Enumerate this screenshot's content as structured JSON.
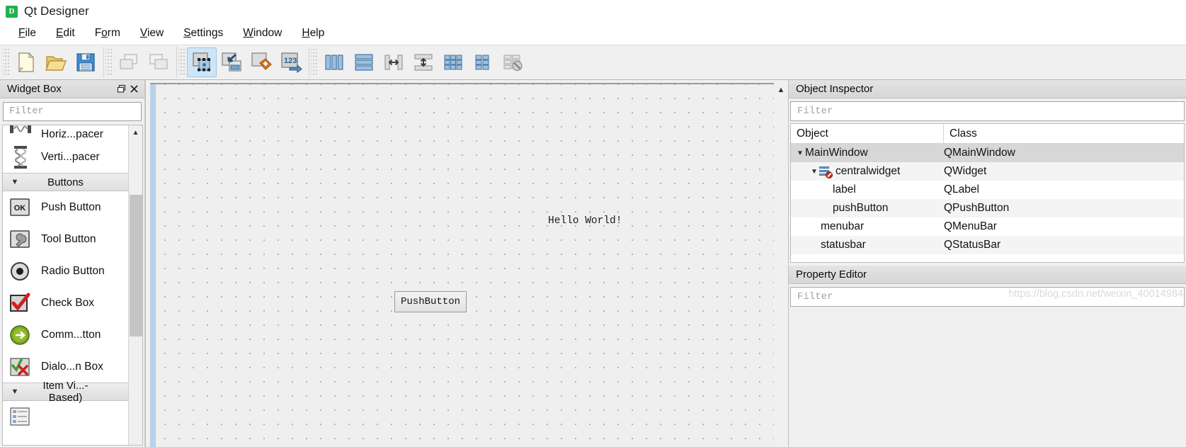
{
  "window": {
    "title": "Qt Designer",
    "icon": "qt-designer-icon",
    "icon_letter": "D"
  },
  "menubar": {
    "items": [
      {
        "label": "File",
        "mnemonic": "F"
      },
      {
        "label": "Edit",
        "mnemonic": "E"
      },
      {
        "label": "Form",
        "mnemonic": "o"
      },
      {
        "label": "View",
        "mnemonic": "V"
      },
      {
        "label": "Settings",
        "mnemonic": "S"
      },
      {
        "label": "Window",
        "mnemonic": "W"
      },
      {
        "label": "Help",
        "mnemonic": "H"
      }
    ]
  },
  "toolbar": {
    "groups": [
      {
        "buttons": [
          {
            "name": "new-form-button",
            "icon": "new-document-icon",
            "active": false
          },
          {
            "name": "open-form-button",
            "icon": "open-folder-icon",
            "active": false
          },
          {
            "name": "save-form-button",
            "icon": "save-floppy-icon",
            "active": false
          }
        ]
      },
      {
        "buttons": [
          {
            "name": "undo-button",
            "icon": "undo-cascade-icon",
            "active": false
          },
          {
            "name": "redo-button",
            "icon": "redo-cascade-icon",
            "active": false
          }
        ]
      },
      {
        "buttons": [
          {
            "name": "edit-widgets-button",
            "icon": "edit-widgets-icon",
            "active": true
          },
          {
            "name": "edit-signals-slots-button",
            "icon": "edit-signals-slots-icon",
            "active": false
          },
          {
            "name": "edit-buddies-button",
            "icon": "edit-buddies-icon",
            "active": false
          },
          {
            "name": "edit-tab-order-button",
            "icon": "edit-tab-order-icon",
            "active": false
          }
        ]
      },
      {
        "buttons": [
          {
            "name": "layout-horizontally-button",
            "icon": "layout-horizontal-icon",
            "active": false
          },
          {
            "name": "layout-vertically-button",
            "icon": "layout-vertical-icon",
            "active": false
          },
          {
            "name": "layout-splitter-horizontal-button",
            "icon": "splitter-horizontal-icon",
            "active": false
          },
          {
            "name": "layout-splitter-vertical-button",
            "icon": "splitter-vertical-icon",
            "active": false
          },
          {
            "name": "layout-grid-button",
            "icon": "layout-grid-icon",
            "active": false
          },
          {
            "name": "layout-form-button",
            "icon": "layout-form-icon",
            "active": false
          },
          {
            "name": "break-layout-button",
            "icon": "break-layout-icon",
            "active": false
          }
        ]
      }
    ]
  },
  "widget_box": {
    "title": "Widget Box",
    "float_button": "restore-icon",
    "close_button": "close-icon",
    "filter_placeholder": "Filter",
    "rows": [
      {
        "type": "item",
        "label": "Horiz...pacer",
        "icon": "horizontal-spacer-icon",
        "clipped": true
      },
      {
        "type": "item",
        "label": "Verti...pacer",
        "icon": "vertical-spacer-icon"
      },
      {
        "type": "category",
        "label": "Buttons",
        "expanded": true
      },
      {
        "type": "item",
        "label": "Push Button",
        "icon": "push-button-icon"
      },
      {
        "type": "item",
        "label": "Tool Button",
        "icon": "tool-button-icon"
      },
      {
        "type": "item",
        "label": "Radio Button",
        "icon": "radio-button-icon"
      },
      {
        "type": "item",
        "label": "Check Box",
        "icon": "check-box-icon"
      },
      {
        "type": "item",
        "label": "Comm...tton",
        "icon": "command-link-button-icon"
      },
      {
        "type": "item",
        "label": "Dialo...n Box",
        "icon": "dialog-button-box-icon"
      },
      {
        "type": "category",
        "label": "Item Vi...-Based)",
        "expanded": true
      }
    ]
  },
  "form": {
    "label_text": "Hello World!",
    "button_text": "PushButton"
  },
  "object_inspector": {
    "title": "Object Inspector",
    "filter_placeholder": "Filter",
    "columns": [
      "Object",
      "Class"
    ],
    "rows": [
      {
        "object": "MainWindow",
        "class": "QMainWindow",
        "indent": 0,
        "expander": "down",
        "selected": true,
        "icon": null
      },
      {
        "object": "centralwidget",
        "class": "QWidget",
        "indent": 1,
        "expander": "down",
        "selected": false,
        "icon": "central-widget-icon",
        "alt": true
      },
      {
        "object": "label",
        "class": "QLabel",
        "indent": 2,
        "expander": null,
        "selected": false,
        "icon": null
      },
      {
        "object": "pushButton",
        "class": "QPushButton",
        "indent": 2,
        "expander": null,
        "selected": false,
        "icon": null,
        "alt": true
      },
      {
        "object": "menubar",
        "class": "QMenuBar",
        "indent": 1,
        "expander": null,
        "selected": false,
        "icon": null
      },
      {
        "object": "statusbar",
        "class": "QStatusBar",
        "indent": 1,
        "expander": null,
        "selected": false,
        "icon": null,
        "alt": true
      }
    ]
  },
  "property_editor": {
    "title": "Property Editor",
    "filter_placeholder": "Filter",
    "watermark": "https://blog.csdn.net/weixin_40014984"
  }
}
